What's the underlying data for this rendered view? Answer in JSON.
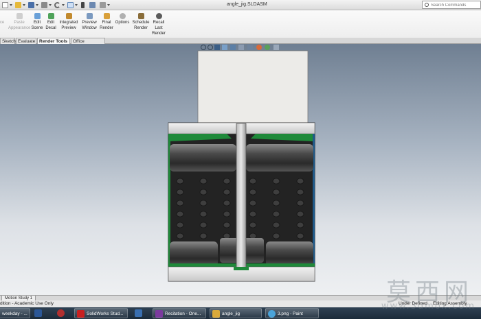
{
  "window": {
    "title": "angle_jig.SLDASM"
  },
  "search": {
    "placeholder": "Search Commands"
  },
  "ribbon": {
    "buttons": [
      {
        "label": "ce",
        "enabled": false
      },
      {
        "label": "Paste\nAppearance",
        "enabled": false
      },
      {
        "label": "Edit\nScene",
        "enabled": true
      },
      {
        "label": "Edit\nDecal",
        "enabled": true
      },
      {
        "label": "Integrated\nPreview",
        "enabled": true
      },
      {
        "label": "Preview\nWindow",
        "enabled": true
      },
      {
        "label": "Final\nRender",
        "enabled": true
      },
      {
        "label": "Options",
        "enabled": true
      },
      {
        "label": "Schedule\nRender",
        "enabled": true
      },
      {
        "label": "Recall\nLast\nRender",
        "enabled": true
      }
    ]
  },
  "tabs": [
    {
      "label": "Sketch",
      "active": false
    },
    {
      "label": "Evaluate",
      "active": false
    },
    {
      "label": "Render Tools",
      "active": true
    },
    {
      "label": "Office Products",
      "active": false
    }
  ],
  "motion": {
    "tab_label": "Motion Study 1"
  },
  "status": {
    "left": "dition - Academic Use Only",
    "defined": "Under Defined",
    "editing": "Editing Assembly"
  },
  "taskbar": {
    "items": [
      {
        "label": "weekday - ...",
        "icon": "folder-icon",
        "color": "#c9a227"
      },
      {
        "label": "",
        "icon": "word-icon",
        "color": "#2b5797"
      },
      {
        "label": "",
        "icon": "cube-icon",
        "color": "#b03030"
      },
      {
        "label": "SolidWorks Stud...",
        "icon": "solidworks-icon",
        "color": "#c82020"
      },
      {
        "label": "",
        "icon": "apex-icon",
        "color": "#3a6fb0"
      },
      {
        "label": "Recitation - One...",
        "icon": "onenote-icon",
        "color": "#7b3a9e"
      },
      {
        "label": "angle_jig",
        "icon": "folder-icon",
        "color": "#d9a93a"
      },
      {
        "label": "3.png - Paint",
        "icon": "paint-icon",
        "color": "#4aa3d9"
      }
    ]
  },
  "watermark": {
    "text": "莫西网",
    "url": "www.3dmox.com"
  },
  "colors": {
    "accent_green": "#1f8a3a",
    "cylinder_dark": "#2a2a2a",
    "plate": "#d8d8d8",
    "taskbar": "#24374a"
  }
}
